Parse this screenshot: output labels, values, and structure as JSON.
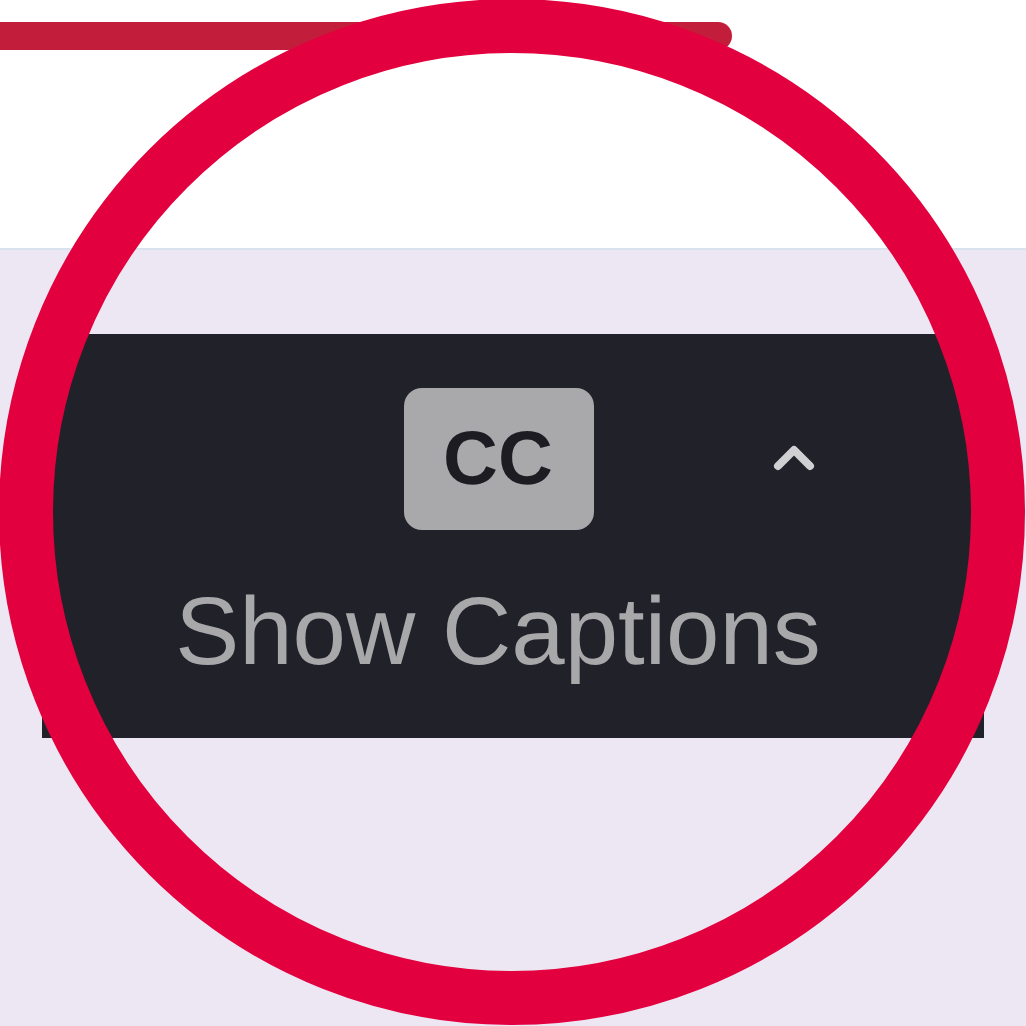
{
  "toolbar": {
    "captions_button": {
      "badge": "CC",
      "label": "Show Captions"
    },
    "menu_caret": {
      "kind": "up"
    }
  },
  "annotation": {
    "kind": "circle"
  }
}
